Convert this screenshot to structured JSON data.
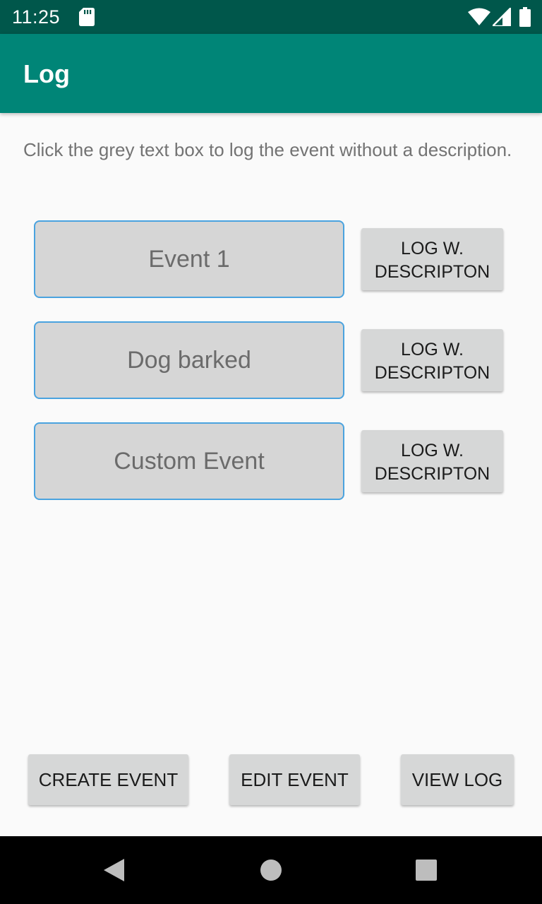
{
  "status_bar": {
    "time": "11:25"
  },
  "app_bar": {
    "title": "Log"
  },
  "hint": "Click the grey text box to log the event without a description.",
  "events": [
    {
      "name": "Event 1",
      "button_label": "LOG W.\nDESCRIPTON"
    },
    {
      "name": "Dog barked",
      "button_label": "LOG W.\nDESCRIPTON"
    },
    {
      "name": "Custom Event",
      "button_label": "LOG W.\nDESCRIPTON"
    }
  ],
  "bottom_buttons": {
    "create": "CREATE EVENT",
    "edit": "EDIT EVENT",
    "view": "VIEW LOG"
  },
  "colors": {
    "status_bar": "#00574b",
    "app_bar": "#008577",
    "event_border": "#4aa3df",
    "button_bg": "#d6d7d7"
  },
  "icons": [
    "sd-card-icon",
    "wifi-icon",
    "signal-icon",
    "battery-icon",
    "back-icon",
    "home-icon",
    "recents-icon"
  ]
}
